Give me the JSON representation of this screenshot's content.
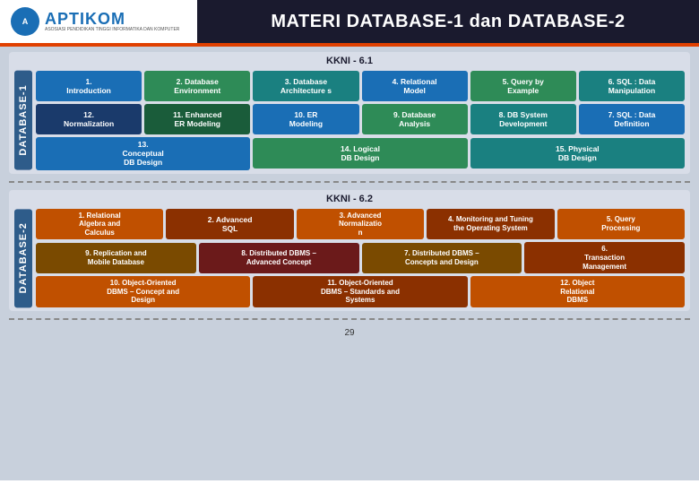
{
  "header": {
    "logo_text": "APTIKOM",
    "logo_sub": "ASOSIASI PENDIDIKAN TINGGI INFORMATIKA DAN KOMPUTER",
    "title": "MATERI DATABASE-1 dan DATABASE-2"
  },
  "db1": {
    "label": "DATABASE-1",
    "kkni": "KKNI - 6.1",
    "row1": [
      {
        "text": "1. Introduction",
        "color": "blue1"
      },
      {
        "text": "2. Database Environment",
        "color": "green1"
      },
      {
        "text": "3. Database Architecture s",
        "color": "teal1"
      },
      {
        "text": "4. Relational Model",
        "color": "blue1"
      },
      {
        "text": "5. Query by Example",
        "color": "green1"
      },
      {
        "text": "6. SQL : Data Manipulation",
        "color": "teal1"
      }
    ],
    "row2": [
      {
        "text": "12. Normalization",
        "color": "darkblue1"
      },
      {
        "text": "11. Enhanced ER Modeling",
        "color": "darkgreen1"
      },
      {
        "text": "10. ER Modeling",
        "color": "blue1"
      },
      {
        "text": "9. Database Analysis",
        "color": "green1"
      },
      {
        "text": "8. DB System Development",
        "color": "teal1"
      },
      {
        "text": "7. SQL : Data Definition",
        "color": "blue1"
      }
    ],
    "row3": [
      {
        "text": "13. Conceptual DB Design",
        "color": "blue1"
      },
      {
        "text": "14. Logical DB Design",
        "color": "green1"
      },
      {
        "text": "15. Physical DB Design",
        "color": "teal1"
      }
    ]
  },
  "db2": {
    "label": "DATABASE-2",
    "kkni": "KKNI - 6.2",
    "row1": [
      {
        "text": "1. Relational Algebra and Calculus",
        "color": "orange"
      },
      {
        "text": "2. Advanced SQL",
        "color": "darkorange"
      },
      {
        "text": "3. Advanced Normalization",
        "color": "orange"
      },
      {
        "text": "4. Monitoring and Tuning the Operating System",
        "color": "darkorange"
      },
      {
        "text": "5. Query Processing",
        "color": "orange"
      }
    ],
    "row2": [
      {
        "text": "9. Replication and Mobile Database",
        "color": "brown"
      },
      {
        "text": "8. Distributed DBMS – Advanced Concept",
        "color": "darkred"
      },
      {
        "text": "7. Distributed DBMS – Concepts and Design",
        "color": "brown"
      },
      {
        "text": "6. Transaction Management",
        "color": "darkorange"
      }
    ],
    "row3": [
      {
        "text": "10. Object-Oriented DBMS – Concept and Design",
        "color": "orange"
      },
      {
        "text": "11. Object-Oriented DBMS – Standards and Systems",
        "color": "darkorange"
      },
      {
        "text": "12. Object Relational DBMS",
        "color": "orange"
      }
    ]
  },
  "page_number": "29"
}
